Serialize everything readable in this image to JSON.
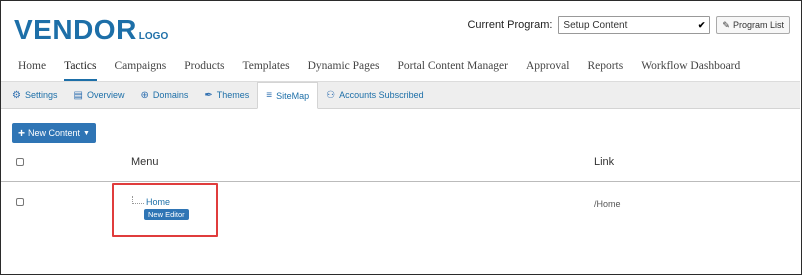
{
  "header": {
    "logo_main": "VENDOR",
    "logo_sub": "LOGO",
    "program_label": "Current Program:",
    "program_value": "Setup Content",
    "program_list_label": "Program List"
  },
  "mainnav": {
    "items": [
      {
        "label": "Home"
      },
      {
        "label": "Tactics",
        "active": true
      },
      {
        "label": "Campaigns"
      },
      {
        "label": "Products"
      },
      {
        "label": "Templates"
      },
      {
        "label": "Dynamic Pages"
      },
      {
        "label": "Portal Content Manager"
      },
      {
        "label": "Approval"
      },
      {
        "label": "Reports"
      },
      {
        "label": "Workflow Dashboard"
      }
    ]
  },
  "subnav": {
    "items": [
      {
        "label": "Settings",
        "icon": "gear-icon"
      },
      {
        "label": "Overview",
        "icon": "document-icon"
      },
      {
        "label": "Domains",
        "icon": "globe-icon"
      },
      {
        "label": "Themes",
        "icon": "paint-brush-icon"
      },
      {
        "label": "SiteMap",
        "icon": "sitemap-icon",
        "active": true
      },
      {
        "label": "Accounts Subscribed",
        "icon": "users-icon"
      }
    ]
  },
  "content": {
    "new_button_label": "New Content",
    "columns": {
      "menu": "Menu",
      "link": "Link"
    },
    "rows": [
      {
        "menu": "Home",
        "badge": "New Editor",
        "link": "/Home"
      }
    ]
  },
  "colors": {
    "brand": "#1d6fa8",
    "button": "#2f75b5",
    "highlight": "#e03c3c"
  }
}
